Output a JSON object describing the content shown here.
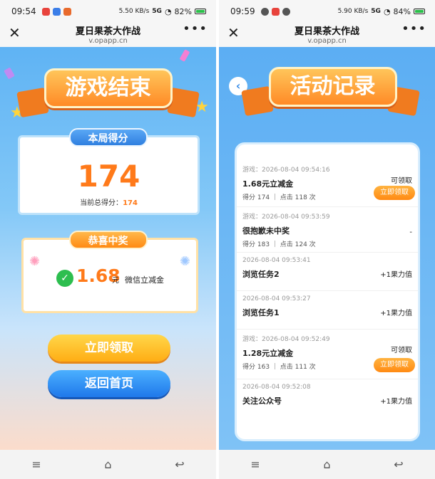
{
  "left": {
    "status": {
      "time": "09:54",
      "speed": "5.50 KB/s",
      "network": "5G",
      "battery": "82%"
    },
    "browser": {
      "title": "夏日果茶大作战",
      "url": "v.opapp.cn"
    },
    "banner": "游戏结束",
    "score_card": {
      "label": "本局得分",
      "score": "174",
      "total_label": "当前总得分：",
      "total_value": "174"
    },
    "prize_card": {
      "label": "恭喜中奖",
      "amount": "1.68",
      "unit": "元",
      "desc": "微信立减金"
    },
    "buttons": {
      "claim": "立即领取",
      "home": "返回首页"
    }
  },
  "right": {
    "status": {
      "time": "09:59",
      "speed": "5.90 KB/s",
      "network": "5G",
      "battery": "84%"
    },
    "browser": {
      "title": "夏日果茶大作战",
      "url": "v.opapp.cn"
    },
    "banner": "活动记录",
    "records": [
      {
        "time": "游戏：2026-08-04 09:54:16",
        "title": "1.68元立减金",
        "sub": "得分 174 ｜ 点击 118 次",
        "status": "可领取",
        "button": "立即领取"
      },
      {
        "time": "游戏：2026-08-04 09:53:59",
        "title": "很抱歉未中奖",
        "sub": "得分 183 ｜ 点击 124 次",
        "status": "-",
        "button": ""
      },
      {
        "time": "2026-08-04 09:53:41",
        "title": "浏览任务2",
        "sub": "",
        "status": "+1果力值",
        "button": ""
      },
      {
        "time": "2026-08-04 09:53:27",
        "title": "浏览任务1",
        "sub": "",
        "status": "+1果力值",
        "button": ""
      },
      {
        "time": "游戏：2026-08-04 09:52:49",
        "title": "1.28元立减金",
        "sub": "得分 163 ｜ 点击 111 次",
        "status": "可领取",
        "button": "立即领取"
      },
      {
        "time": "2026-08-04 09:52:08",
        "title": "关注公众号",
        "sub": "",
        "status": "+1果力值",
        "button": ""
      }
    ]
  },
  "icons": {
    "close": "close-icon",
    "more": "more-icon",
    "back": "back-arrow-icon",
    "menu": "menu-icon",
    "home": "home-icon",
    "return": "return-icon",
    "wechat": "wechat-pay-icon"
  },
  "colors": {
    "accent_orange": "#ff8a13",
    "sky_blue": "#5fb3f4",
    "score_orange": "#ff7a1a"
  }
}
